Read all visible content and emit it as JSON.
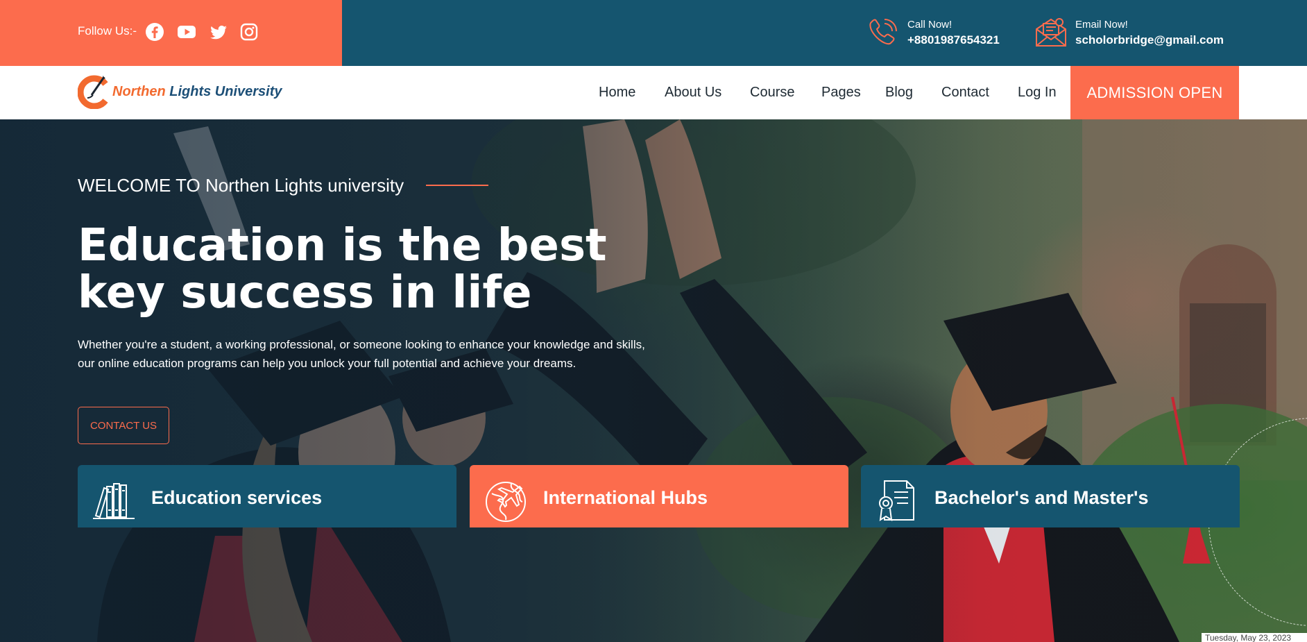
{
  "topbar": {
    "follow_label": "Follow Us:-",
    "socials": [
      {
        "icon": "facebook-icon"
      },
      {
        "icon": "youtube-icon"
      },
      {
        "icon": "twitter-icon"
      },
      {
        "icon": "instagram-icon"
      }
    ],
    "call": {
      "label": "Call Now!",
      "value": "+8801987654321"
    },
    "email": {
      "label": "Email Now!",
      "value": "scholorbridge@gmail.com"
    }
  },
  "nav": {
    "logo_part1": "Northen",
    "logo_part2": "Lights University",
    "items": [
      "Home",
      "About Us",
      "Course",
      "Pages",
      "Blog",
      "Contact",
      "Log In"
    ],
    "admission_label": "ADMISSION OPEN"
  },
  "hero": {
    "welcome": "WELCOME TO Northen Lights university",
    "headline": "Education is the best key success in life",
    "subtext": "Whether you're a student, a working professional, or someone looking to enhance your knowledge and skills, our online education programs can help you unlock your full potential and achieve your dreams.",
    "cta_label": "CONTACT US"
  },
  "cards": [
    {
      "title": "Education services",
      "icon": "books-icon",
      "color": "#15556f"
    },
    {
      "title": "International Hubs",
      "icon": "globe-plane-icon",
      "color": "#fc6c4d"
    },
    {
      "title": "Bachelor's and Master's",
      "icon": "certificate-icon",
      "color": "#15556f"
    }
  ],
  "date_stamp": "Tuesday, May 23, 2023",
  "colors": {
    "brand_orange": "#fc6c4d",
    "brand_blue": "#15556f"
  }
}
